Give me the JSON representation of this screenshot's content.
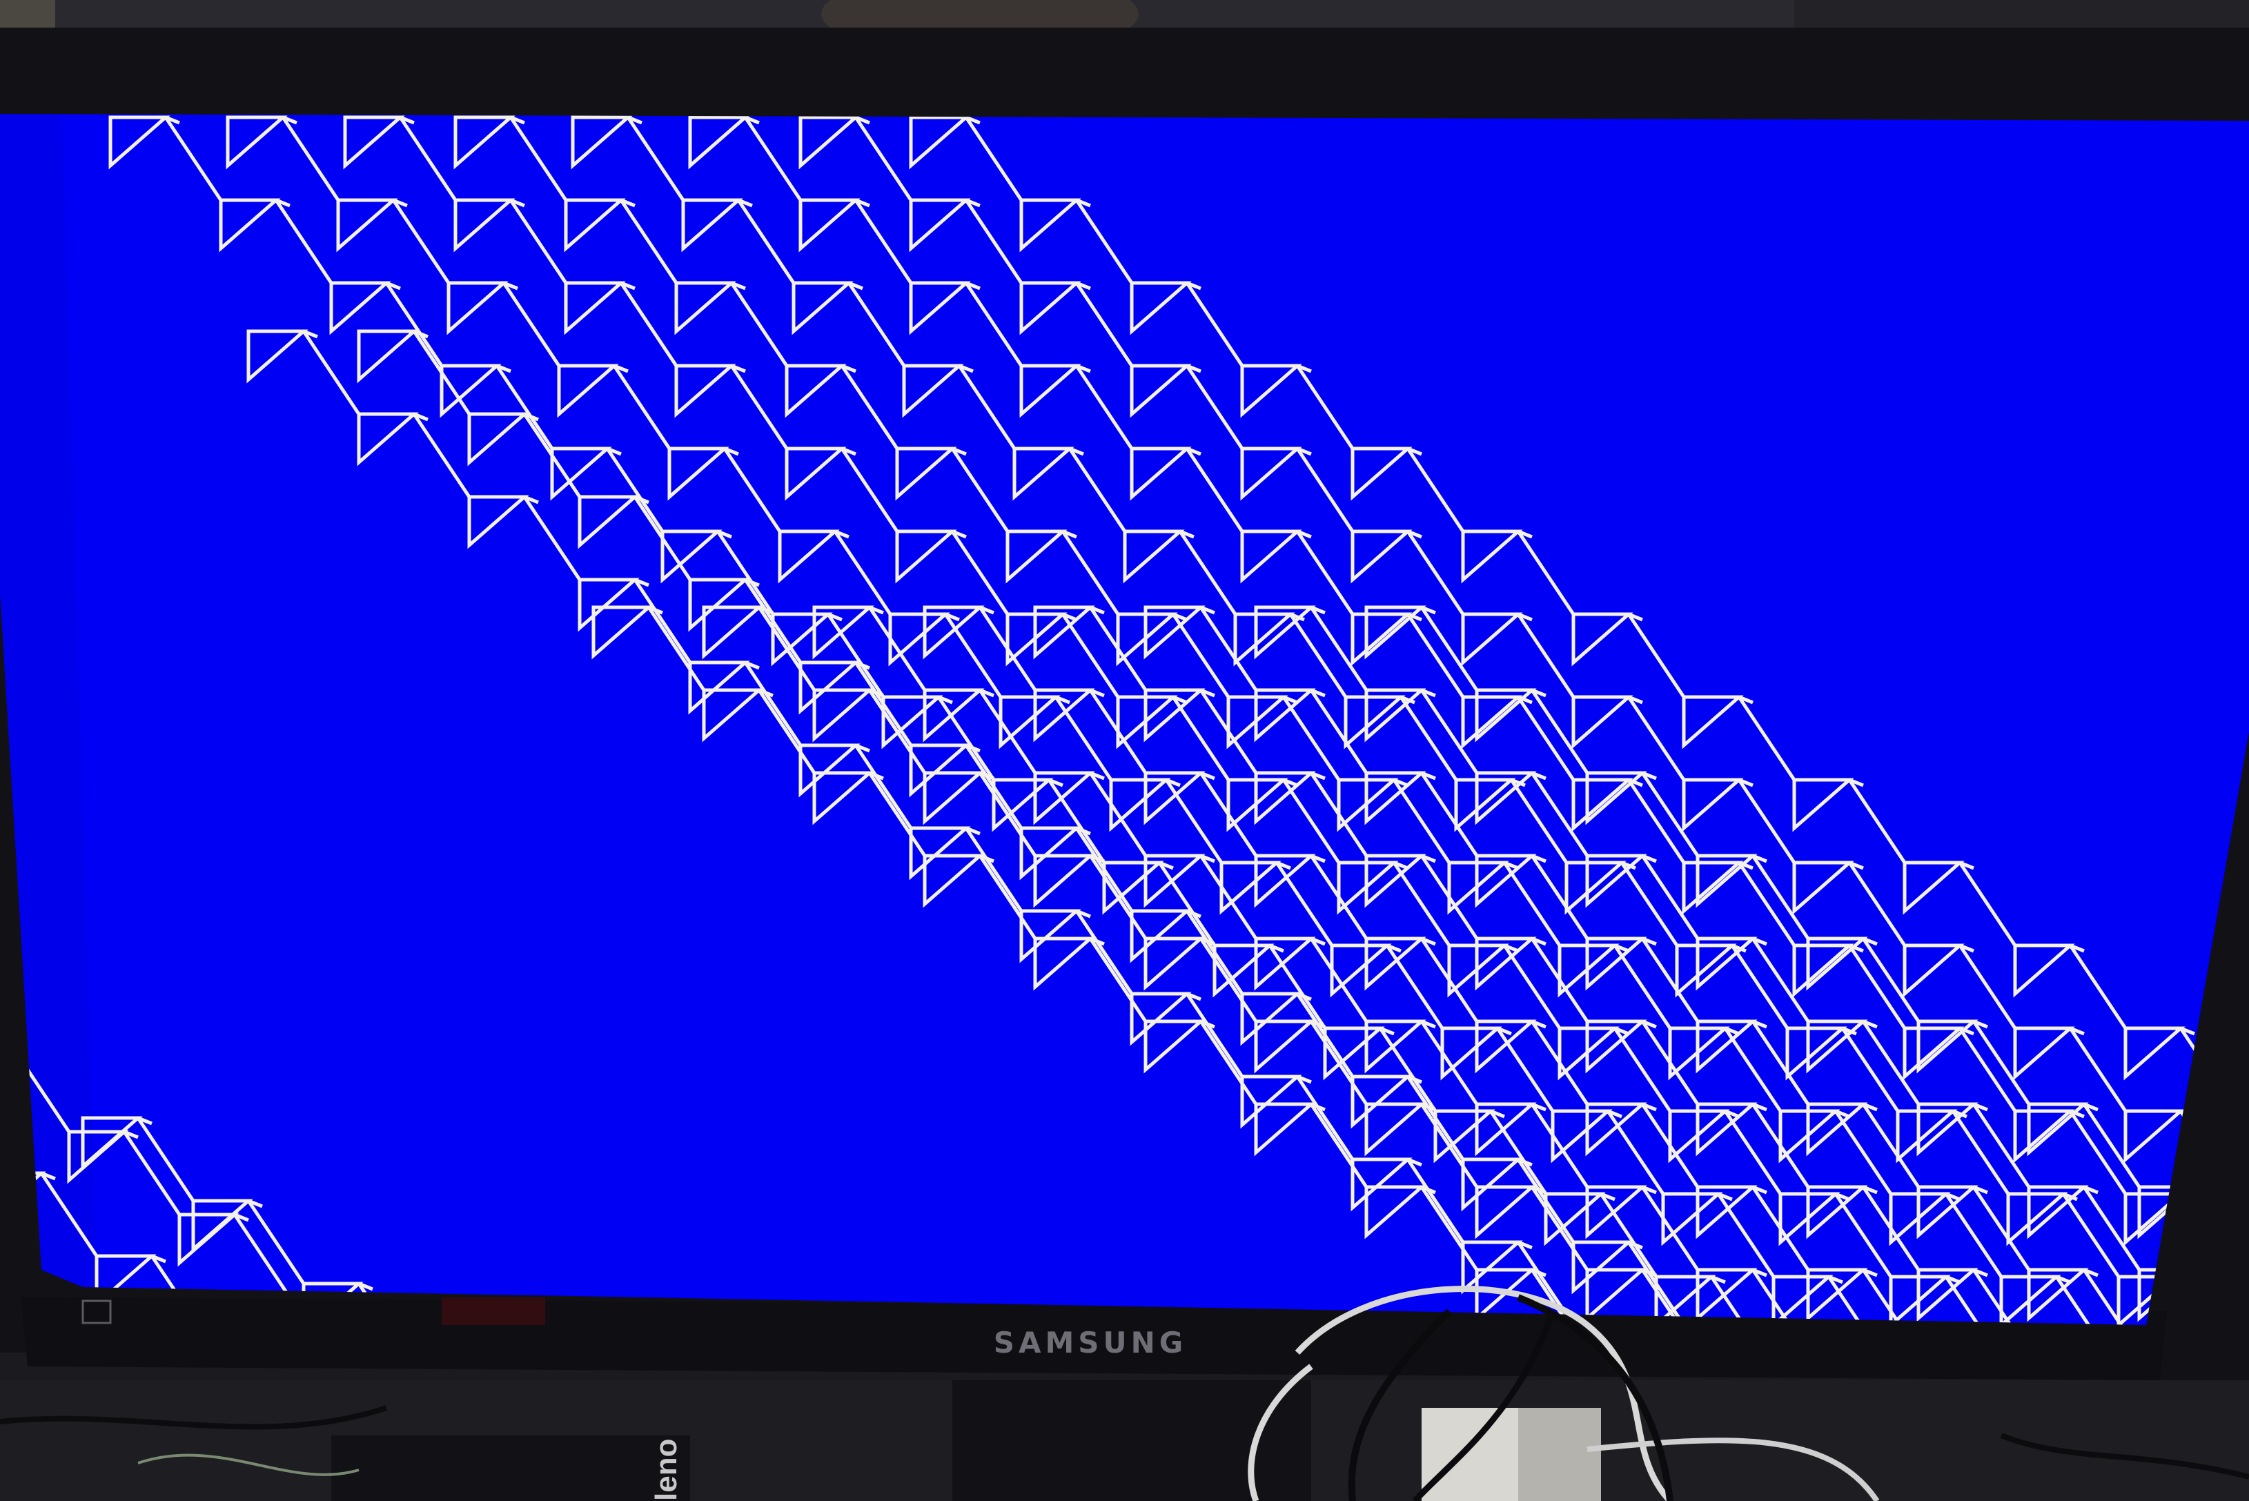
{
  "monitor": {
    "brand_label": "SAMSUNG"
  },
  "desk": {
    "power_adapter_label": "leno"
  },
  "screen": {
    "background_color": "#0000f5",
    "pattern_stroke_color": "#f4f2e8",
    "pattern_description": "repeating_zigzag_triangles"
  },
  "colors": {
    "bezel": "#121116",
    "room_dark": "#1b1a1f",
    "cable_white": "#d8d8d8",
    "cable_black": "#0b0b0d"
  }
}
